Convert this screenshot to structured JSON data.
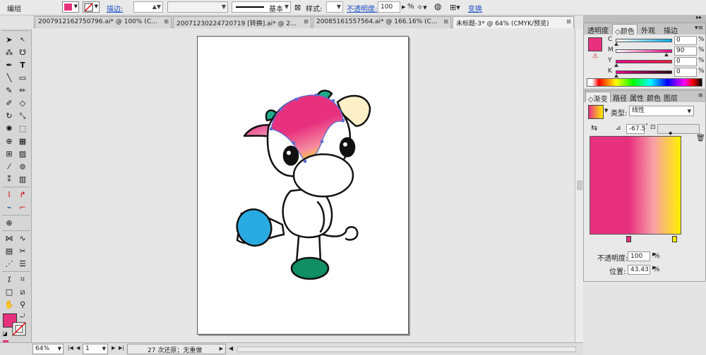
{
  "control_bar": {
    "mode_label": "编组",
    "stroke_label": "描边:",
    "brush_label": "基本",
    "style_label": "样式:",
    "opacity_label": "不透明度:",
    "opacity_value": "100",
    "opacity_unit": "%",
    "transform_label": "变换"
  },
  "tabs": [
    {
      "label": "2007912162750796.ai* @ 100% (C..."
    },
    {
      "label": "20071230224720719  [转换].ai* @ 2..."
    },
    {
      "label": "20085161557564.ai* @ 166.16% (C..."
    },
    {
      "label": "未标题-3* @ 64% (CMYK/预览)"
    }
  ],
  "color_panel": {
    "tabs": [
      "透明度",
      "颜色",
      "外观",
      "描边"
    ],
    "channels": [
      {
        "label": "C",
        "value": "0"
      },
      {
        "label": "M",
        "value": "90"
      },
      {
        "label": "Y",
        "value": "0"
      },
      {
        "label": "K",
        "value": "0"
      }
    ],
    "unit": "%"
  },
  "gradient_panel": {
    "tabs": [
      "渐变",
      "路径",
      "属性",
      "颜色",
      "图层"
    ],
    "type_label": "类型:",
    "type_value": "线性",
    "angle_value": "-67.5",
    "angle_unit": "°",
    "opacity_label": "不透明度:",
    "opacity_value": "100",
    "location_label": "位置:",
    "location_value": "43.43",
    "unit": "%"
  },
  "status_bar": {
    "zoom": "64%",
    "artboard": "1",
    "status_text": "27 次还原；无重做"
  },
  "colors": {
    "magenta": "#e8317e",
    "yellow": "#ffef00",
    "cyan": "#29abe2",
    "green": "#0f8f63"
  }
}
